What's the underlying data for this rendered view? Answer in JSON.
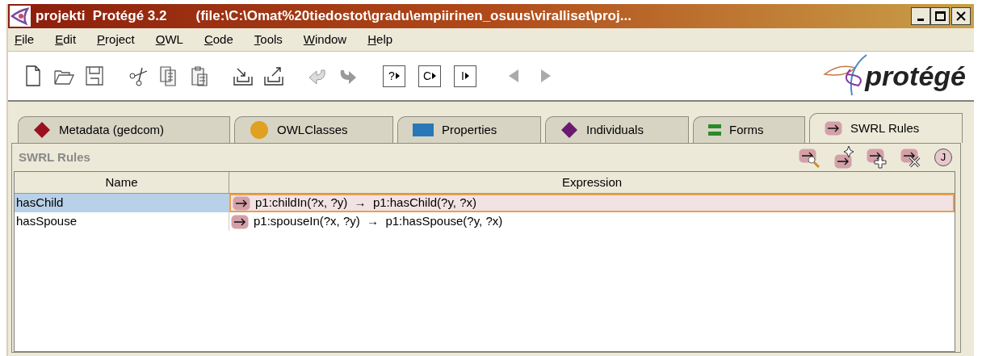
{
  "window": {
    "title": "projekti  Protégé 3.2",
    "path": "(file:\\C:\\Omat%20tiedostot\\gradu\\empiirinen_osuus\\viralliset\\proj..."
  },
  "menu": [
    "File",
    "Edit",
    "Project",
    "OWL",
    "Code",
    "Tools",
    "Window",
    "Help"
  ],
  "toolbar_query_buttons": [
    "?",
    "C",
    "I"
  ],
  "logo": {
    "text": "protégé"
  },
  "tabs": [
    {
      "label": "Metadata (gedcom)",
      "kind": "diamond",
      "color": "#9b1020",
      "selected": false
    },
    {
      "label": "OWLClasses",
      "kind": "circle",
      "color": "#e0a020",
      "selected": false
    },
    {
      "label": "Properties",
      "kind": "square",
      "color": "#2878b8",
      "selected": false
    },
    {
      "label": "Individuals",
      "kind": "diamond",
      "color": "#6a1a70",
      "selected": false
    },
    {
      "label": "Forms",
      "kind": "bars",
      "color": "#2a8a2a",
      "selected": false
    },
    {
      "label": "SWRL Rules",
      "kind": "rule",
      "color": "#d4a0a8",
      "selected": true
    }
  ],
  "panel": {
    "title": "SWRL Rules",
    "jess_button": "J"
  },
  "table": {
    "columns": [
      "Name",
      "Expression"
    ],
    "rows": [
      {
        "name": "hasChild",
        "expression": "p1:childIn(?x, ?y)  →  p1:hasChild(?y, ?x)",
        "selected": true
      },
      {
        "name": "hasSpouse",
        "expression": "p1:spouseIn(?x, ?y)  →  p1:hasSpouse(?y, ?x)",
        "selected": false
      }
    ]
  }
}
